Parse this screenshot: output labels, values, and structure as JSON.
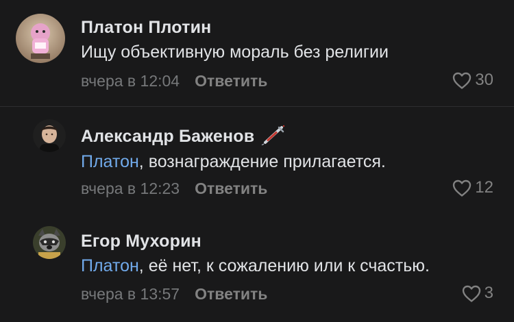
{
  "colors": {
    "background": "#19191a",
    "text": "#e1e3e6",
    "mention": "#71aaeb",
    "secondary": "#828282",
    "time": "#76787a"
  },
  "comments": [
    {
      "author": "Платон Плотин",
      "mention": "",
      "text": "Ищу объективную мораль без религии",
      "time": "вчера в 12:04",
      "reply_label": "Ответить",
      "likes": "30",
      "like_icon": "heart-outline-icon"
    },
    {
      "author": "Александр Баженов",
      "author_icon": "syringe-icon",
      "mention": "Платон",
      "text": ", вознаграждение прилагается.",
      "time": "вчера в 12:23",
      "reply_label": "Ответить",
      "likes": "12",
      "like_icon": "heart-outline-icon"
    },
    {
      "author": "Егор Мухорин",
      "mention": "Платон",
      "text": ", её нет, к сожалению или к счастью.",
      "time": "вчера в 13:57",
      "reply_label": "Ответить",
      "likes": "3",
      "like_icon": "heart-outline-icon"
    }
  ]
}
